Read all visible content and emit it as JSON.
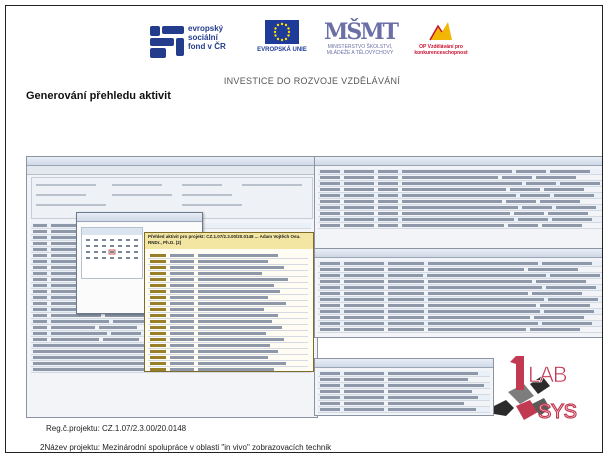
{
  "header": {
    "logos": {
      "esf": "evropský sociální fond v ČR",
      "eu": "EVROPSKÁ UNIE",
      "msmt_symbol": "MŠMT",
      "msmt": "MINISTERSTVO ŠKOLSTVÍ, MLÁDEŽE A TĚLOVÝCHOVY",
      "op": "OP Vzdělávání pro konkurenceschopnost"
    },
    "tagline": "INVESTICE DO ROZVOJE VZDĚLÁVÁNÍ"
  },
  "slide": {
    "title": "Generování přehledu aktivit",
    "reg_number": "Reg.č.projektu: CZ.1.07/2.3.00/20.0148",
    "project_name": "2Název projektu: Mezinárodní spolupráce v oblasti \"in vivo\" zobrazovacích technik"
  },
  "screenshot": {
    "detail_header": "Přehled aktivit pro projekt: CZ.1.07/2.3.00/20.0148 ... Adam Vojtěch Osu. RNDr., Ph.D. (2)"
  },
  "labsys_logo": {
    "top": "LAB",
    "bottom": "SYS"
  },
  "colors": {
    "esf_blue": "#233d8c",
    "eu_blue": "#1e3b9a",
    "msmt_purple": "#6b6fa6",
    "op_red": "#c8102e",
    "labsys_red": "#c23a52"
  }
}
